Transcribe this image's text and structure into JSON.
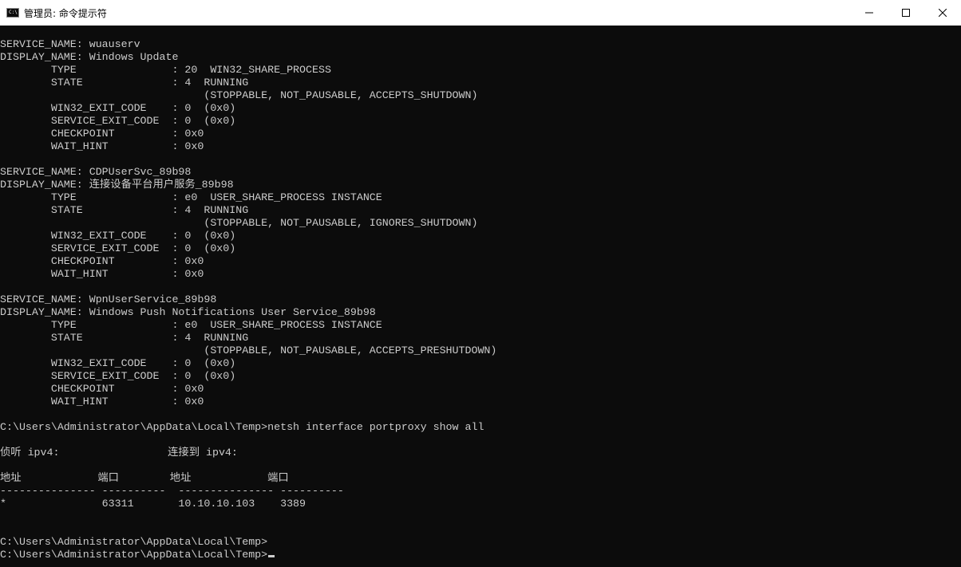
{
  "window": {
    "title": "管理员: 命令提示符",
    "app_icon_text": "C:\\",
    "controls": {
      "minimize": "minimize-icon",
      "maximize": "maximize-icon",
      "close": "close-icon"
    }
  },
  "console": {
    "lines": [
      "SERVICE_NAME: wuauserv",
      "DISPLAY_NAME: Windows Update",
      "        TYPE               : 20  WIN32_SHARE_PROCESS",
      "        STATE              : 4  RUNNING",
      "                                (STOPPABLE, NOT_PAUSABLE, ACCEPTS_SHUTDOWN)",
      "        WIN32_EXIT_CODE    : 0  (0x0)",
      "        SERVICE_EXIT_CODE  : 0  (0x0)",
      "        CHECKPOINT         : 0x0",
      "        WAIT_HINT          : 0x0",
      "",
      "SERVICE_NAME: CDPUserSvc_89b98",
      "DISPLAY_NAME: 连接设备平台用户服务_89b98",
      "        TYPE               : e0  USER_SHARE_PROCESS INSTANCE",
      "        STATE              : 4  RUNNING",
      "                                (STOPPABLE, NOT_PAUSABLE, IGNORES_SHUTDOWN)",
      "        WIN32_EXIT_CODE    : 0  (0x0)",
      "        SERVICE_EXIT_CODE  : 0  (0x0)",
      "        CHECKPOINT         : 0x0",
      "        WAIT_HINT          : 0x0",
      "",
      "SERVICE_NAME: WpnUserService_89b98",
      "DISPLAY_NAME: Windows Push Notifications User Service_89b98",
      "        TYPE               : e0  USER_SHARE_PROCESS INSTANCE",
      "        STATE              : 4  RUNNING",
      "                                (STOPPABLE, NOT_PAUSABLE, ACCEPTS_PRESHUTDOWN)",
      "        WIN32_EXIT_CODE    : 0  (0x0)",
      "        SERVICE_EXIT_CODE  : 0  (0x0)",
      "        CHECKPOINT         : 0x0",
      "        WAIT_HINT          : 0x0",
      "",
      "C:\\Users\\Administrator\\AppData\\Local\\Temp>netsh interface portproxy show all",
      "",
      "侦听 ipv4:                 连接到 ipv4:",
      "",
      "地址            端口        地址            端口",
      "--------------- ----------  --------------- ----------",
      "*               63311       10.10.10.103    3389",
      "",
      "",
      "C:\\Users\\Administrator\\AppData\\Local\\Temp>",
      "C:\\Users\\Administrator\\AppData\\Local\\Temp>"
    ]
  },
  "colors": {
    "console_bg": "#0c0c0c",
    "console_fg": "#cccccc",
    "titlebar_bg": "#ffffff"
  }
}
